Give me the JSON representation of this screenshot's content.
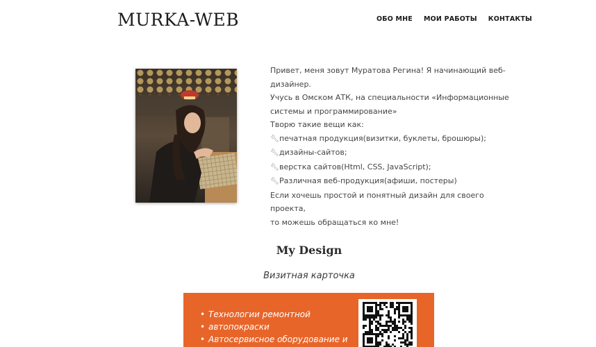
{
  "header": {
    "logo": "MURKA-WEB",
    "nav": [
      "ОБО МНЕ",
      "МОИ РАБОТЫ",
      "КОНТАКТЫ"
    ]
  },
  "about": {
    "lines": [
      "Привет, меня зовут Муратова Регина! Я начинающий веб-",
      "дизайнер.",
      "Учусь в Омском АТК, на специальности «Информационные",
      "системы и программирование»",
      "Творю такие вещи как:"
    ],
    "skills": [
      "печатная продукция(визитки, буклеты, брошюры);",
      "дизайны-сайтов;",
      "верстка сайтов(Html, CSS, JavaScript);",
      "Различная веб-продукция(афиши, постеры)"
    ],
    "closing": [
      "Если хочешь простой и понятный дизайн для своего проекта,",
      "то можешь обращаться ко мне!"
    ],
    "skill_icon": "wrench-icon"
  },
  "portfolio": {
    "section_title": "My Design",
    "subtitle": "Визитная карточка",
    "card": {
      "bullets": [
        "Технологии ремонтной",
        "автопокраски",
        "Автосервисное оборудование и"
      ],
      "color": "#e8652a"
    }
  }
}
